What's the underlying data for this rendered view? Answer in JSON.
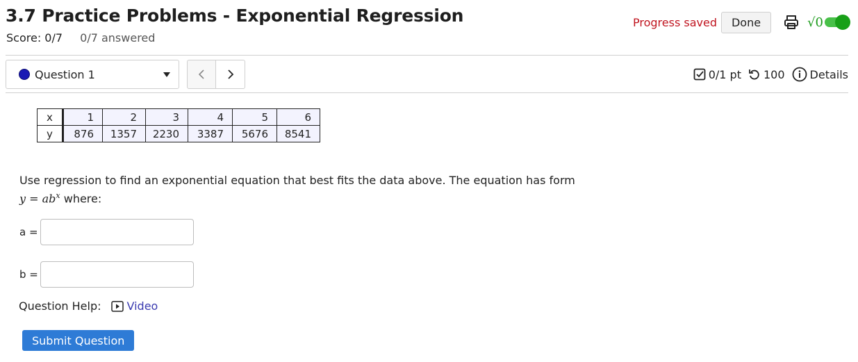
{
  "header": {
    "title": "3.7 Practice Problems - Exponential Regression",
    "score": "Score: 0/7",
    "answered": "0/7 answered",
    "progress_status": "Progress saved",
    "done_label": "Done"
  },
  "nav": {
    "question_select": "Question 1",
    "prev_label": "<",
    "next_label": ">"
  },
  "meta": {
    "points": "0/1 pt",
    "attempts": "100",
    "details_label": "Details"
  },
  "table": {
    "x_label": "x",
    "y_label": "y",
    "x": [
      "1",
      "2",
      "3",
      "4",
      "5",
      "6"
    ],
    "y": [
      "876",
      "1357",
      "2230",
      "3387",
      "5676",
      "8541"
    ]
  },
  "question": {
    "prompt": "Use regression to find an exponential equation that best fits the data above. The equation has form",
    "equation_lhs": "y",
    "equation_eq": "=",
    "equation_rhs": "ab",
    "equation_exp": "x",
    "equation_suffix": "where:",
    "a_label": "a =",
    "a_value": "",
    "b_label": "b =",
    "b_value": "",
    "help_label": "Question Help:",
    "video_label": "Video",
    "submit_label": "Submit Question"
  },
  "colors": {
    "progress": "#c0141f",
    "accent": "#2e7bd6",
    "toggle": "#18a018",
    "link": "#3a3ab0"
  }
}
